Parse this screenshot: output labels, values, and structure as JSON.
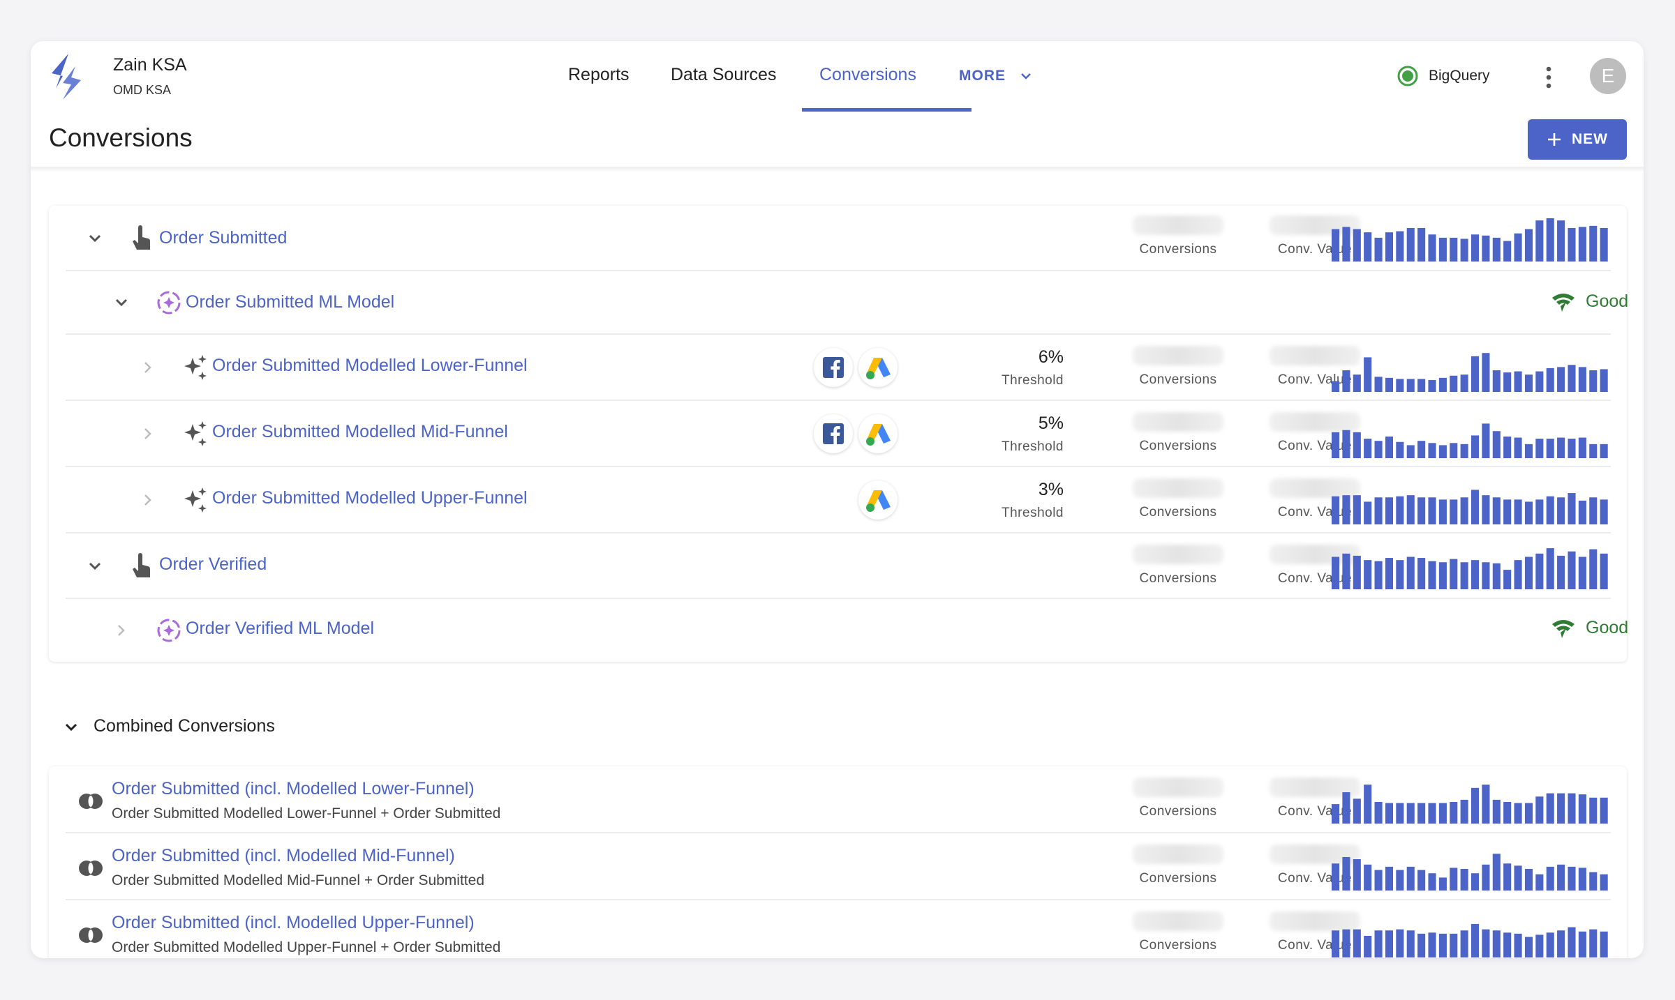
{
  "brand": {
    "name": "Zain KSA",
    "subtitle": "OMD KSA"
  },
  "nav": {
    "items": [
      {
        "label": "Reports"
      },
      {
        "label": "Data Sources"
      },
      {
        "label": "Conversions",
        "active": true
      }
    ],
    "more_label": "MORE"
  },
  "datasource": {
    "label": "BigQuery",
    "status_color": "#43a047"
  },
  "user": {
    "avatar_initial": "E"
  },
  "page": {
    "title": "Conversions",
    "new_button_label": "NEW"
  },
  "colors": {
    "accent": "#4c63c8",
    "good": "#2e7d32",
    "ml_icon": "#a86bd9"
  },
  "labels": {
    "conversions": "Conversions",
    "conv_value": "Conv. Value",
    "threshold": "Threshold",
    "good": "Good"
  },
  "conversions": [
    {
      "name": "Order Submitted",
      "type": "event",
      "spark": [
        30,
        32,
        30,
        27,
        22,
        27,
        28,
        31,
        31,
        25,
        22,
        22,
        21,
        25,
        24,
        22,
        19,
        26,
        30,
        38,
        40,
        38,
        31,
        32,
        33,
        31
      ]
    },
    {
      "name": "Order Submitted ML Model",
      "type": "ml-model",
      "status": "Good"
    },
    {
      "name": "Order Submitted Modelled Lower-Funnel",
      "type": "modelled",
      "platforms": [
        "facebook",
        "google-ads"
      ],
      "threshold": "6%",
      "spark": [
        10,
        20,
        16,
        32,
        14,
        13,
        12,
        12,
        12,
        11,
        13,
        15,
        16,
        33,
        36,
        20,
        18,
        19,
        16,
        19,
        22,
        23,
        25,
        23,
        20,
        21
      ]
    },
    {
      "name": "Order Submitted Modelled Mid-Funnel",
      "type": "modelled",
      "platforms": [
        "facebook",
        "google-ads"
      ],
      "threshold": "5%",
      "spark": [
        24,
        26,
        24,
        18,
        16,
        20,
        15,
        12,
        16,
        14,
        12,
        14,
        13,
        21,
        32,
        25,
        20,
        19,
        13,
        18,
        18,
        19,
        18,
        19,
        13,
        13
      ]
    },
    {
      "name": "Order Submitted Modelled Upper-Funnel",
      "type": "modelled",
      "platforms": [
        "google-ads"
      ],
      "threshold": "3%",
      "spark": [
        26,
        27,
        27,
        21,
        25,
        25,
        26,
        27,
        25,
        25,
        23,
        23,
        25,
        32,
        27,
        25,
        23,
        23,
        21,
        23,
        26,
        25,
        29,
        22,
        25,
        23
      ]
    },
    {
      "name": "Order Verified",
      "type": "event",
      "spark": [
        30,
        33,
        31,
        27,
        26,
        29,
        27,
        30,
        29,
        26,
        25,
        28,
        25,
        27,
        25,
        24,
        18,
        27,
        30,
        33,
        38,
        31,
        35,
        30,
        37,
        33
      ]
    },
    {
      "name": "Order Verified ML Model",
      "type": "ml-model",
      "status": "Good"
    }
  ],
  "combined": {
    "title": "Combined Conversions",
    "items": [
      {
        "name": "Order Submitted (incl. Modelled Lower-Funnel)",
        "description": "Order Submitted Modelled Lower-Funnel + Order Submitted",
        "spark": [
          18,
          29,
          23,
          36,
          20,
          19,
          19,
          19,
          19,
          19,
          19,
          20,
          22,
          33,
          36,
          22,
          20,
          19,
          19,
          25,
          28,
          28,
          28,
          27,
          24,
          24
        ]
      },
      {
        "name": "Order Submitted (incl. Modelled Mid-Funnel)",
        "description": "Order Submitted Modelled Mid-Funnel + Order Submitted",
        "spark": [
          25,
          31,
          29,
          24,
          19,
          22,
          19,
          22,
          19,
          16,
          12,
          21,
          20,
          16,
          24,
          34,
          25,
          23,
          20,
          15,
          22,
          24,
          22,
          21,
          17,
          15
        ]
      },
      {
        "name": "Order Submitted (incl. Modelled Upper-Funnel)",
        "description": "Order Submitted Modelled Upper-Funnel + Order Submitted",
        "spark": [
          25,
          26,
          26,
          20,
          25,
          25,
          26,
          25,
          22,
          23,
          22,
          22,
          25,
          31,
          26,
          25,
          23,
          22,
          19,
          21,
          23,
          25,
          28,
          24,
          26,
          24
        ]
      }
    ]
  }
}
